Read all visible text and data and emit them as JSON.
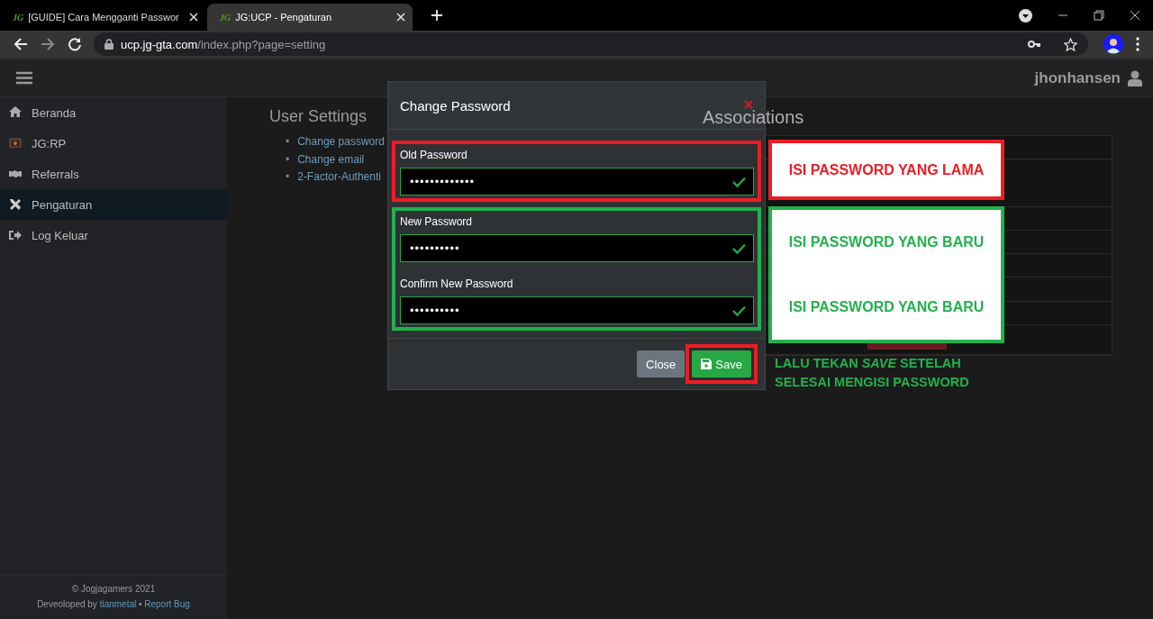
{
  "browser": {
    "tabs": [
      {
        "favicon": "JG",
        "title": "[GUIDE] Cara Mengganti Passwor",
        "selected": false
      },
      {
        "favicon": "JG",
        "title": "JG:UCP - Pengaturan",
        "selected": true
      }
    ],
    "url": {
      "host": "ucp.jg-gta.com",
      "path": "/index.php?page=setting"
    }
  },
  "navbar": {
    "username": "jhonhansen"
  },
  "sidebar": {
    "items": [
      {
        "label": "Beranda",
        "selected": false
      },
      {
        "label": "JG:RP",
        "selected": false
      },
      {
        "label": "Referrals",
        "selected": false
      },
      {
        "label": "Pengaturan",
        "selected": true
      },
      {
        "label": "Log Keluar",
        "selected": false
      }
    ],
    "footer": {
      "copyright": "© Jogjagamers 2021",
      "credit": "Deveoloped by",
      "author": "tianmetal",
      "separator": "•",
      "report": "Report Bug"
    }
  },
  "user_settings": {
    "title": "User Settings",
    "bullet": "•",
    "links": [
      "Change password",
      "Change email",
      "2-Factor-Authenti"
    ]
  },
  "associations": {
    "title": "Associations"
  },
  "modal": {
    "title": "Change Password",
    "groups": [
      {
        "color": "#ed1c24",
        "fields": [
          {
            "label": "Old Password",
            "value": "•••••••••••••",
            "valid": true
          }
        ]
      },
      {
        "color": "#22b14c",
        "fields": [
          {
            "label": "New Password",
            "value": "••••••••••",
            "valid": true
          },
          {
            "label": "Confirm New Password",
            "value": "••••••••••",
            "valid": true
          }
        ]
      }
    ],
    "buttons": [
      {
        "label": "Close",
        "kind": "secondary",
        "highlighted": false
      },
      {
        "label": "Save",
        "kind": "primary",
        "highlighted": true
      }
    ]
  },
  "notes": [
    {
      "color": "#ed1c24",
      "texts": [
        "ISI PASSWORD YANG LAMA"
      ]
    },
    {
      "color": "#22b14c",
      "texts": [
        "ISI PASSWORD YANG BARU",
        "ISI PASSWORD YANG BARU"
      ]
    }
  ],
  "instruction": {
    "color": "#22b14c",
    "text": "LALU TEKAN *SAVE* SETELAH\nSELESAI MENGISI PASSWORD"
  }
}
